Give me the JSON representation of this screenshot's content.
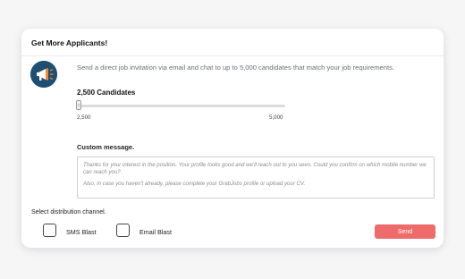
{
  "card": {
    "title": "Get More Applicants!"
  },
  "invite": {
    "icon": "megaphone-icon",
    "description": "Send a direct job invitation via email and chat to up to 5,000 candidates that match your job requirements."
  },
  "slider": {
    "current_label": "2,500 Candidates",
    "min_label": "2,500",
    "max_label": "5,000",
    "value": 2500,
    "min": 2500,
    "max": 5000
  },
  "message": {
    "label": "Custom message.",
    "paragraph_1": "Thanks for your interest in the position. Your profile looks good and we'll reach out to you seen. Could you confirm on which mobile number we can reach you?",
    "paragraph_2": "Also, in case you haven't already, please complete your GrabJobs profile or upload your CV."
  },
  "distribution": {
    "label": "Select distribution channel.",
    "options": [
      {
        "label": "SMS Blast",
        "checked": false
      },
      {
        "label": "Email Blast",
        "checked": false
      }
    ],
    "send_label": "Send"
  },
  "colors": {
    "accent": "#ef6b6b",
    "avatar_bg": "#1f4e73"
  }
}
